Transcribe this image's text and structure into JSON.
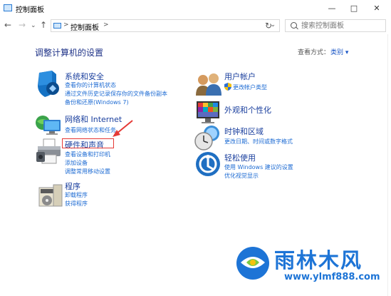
{
  "window": {
    "title": "控制面板",
    "minimize": "—",
    "maximize": "□",
    "close": "✕"
  },
  "nav": {
    "back": "←",
    "forward": "→",
    "dropdown": "⌄",
    "up": "↑",
    "refresh": "↻"
  },
  "address": {
    "sep": ">",
    "path": "控制面板",
    "sep2": ">",
    "drop": "⌄"
  },
  "search": {
    "placeholder": "搜索控制面板"
  },
  "main": {
    "heading": "调整计算机的设置",
    "view_by_label": "查看方式：",
    "view_by_value": "类别 ▾"
  },
  "categories": [
    {
      "title": "系统和安全",
      "links": [
        "查看你的计算机状态",
        "通过文件历史记录保存你的文件备份副本",
        "备份和还原(Windows 7)"
      ]
    },
    {
      "title": "网络和 Internet",
      "links": [
        "查看网络状态和任务"
      ]
    },
    {
      "title": "硬件和声音",
      "links": [
        "查看设备和打印机",
        "添加设备",
        "调整常用移动设置"
      ]
    },
    {
      "title": "程序",
      "links": [
        "卸载程序",
        "获得程序"
      ]
    },
    {
      "title": "用户帐户",
      "links": [
        "更改帐户类型"
      ]
    },
    {
      "title": "外观和个性化",
      "links": []
    },
    {
      "title": "时钟和区域",
      "links": [
        "更改日期、时间或数字格式"
      ]
    },
    {
      "title": "轻松使用",
      "links": [
        "使用 Windows 建议的设置",
        "优化视觉显示"
      ]
    }
  ],
  "watermark": {
    "text": "雨林木风",
    "url": "www.ylmf888.com"
  },
  "colors": {
    "link": "#1d6bd3",
    "category_title": "#1a3f9e",
    "highlight": "#e53935",
    "watermark": "#1d74d6"
  }
}
